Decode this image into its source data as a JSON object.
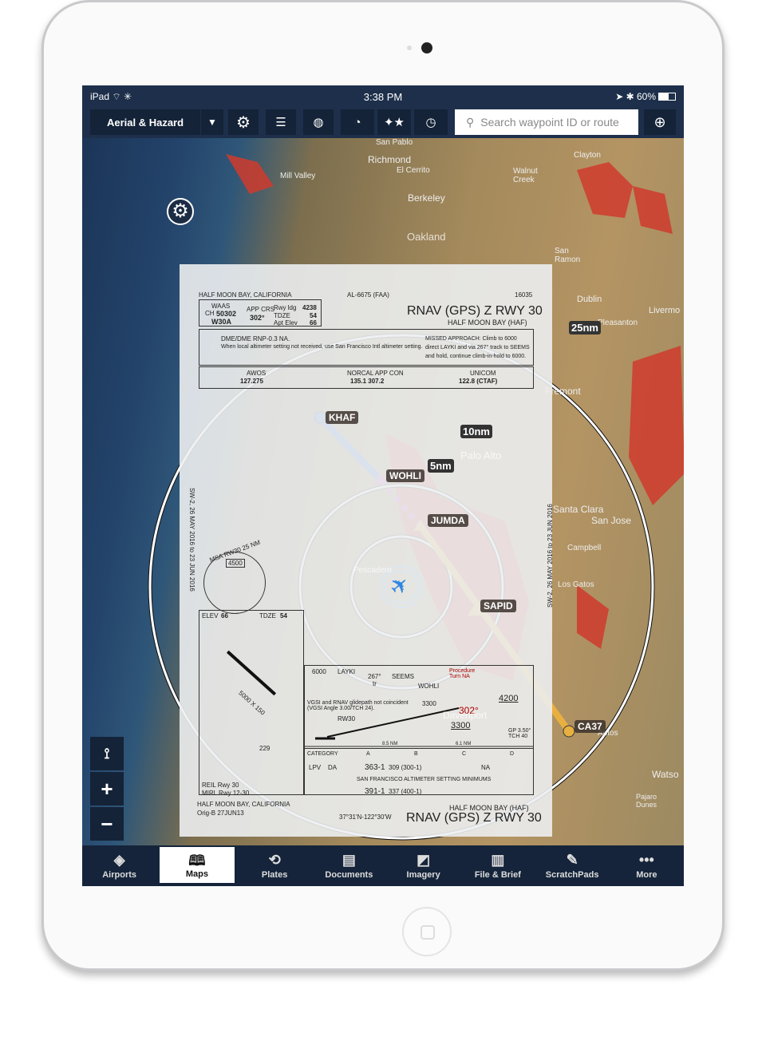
{
  "status_bar": {
    "device": "iPad",
    "time": "3:38 PM",
    "battery": "60%"
  },
  "toolbar": {
    "layer_selector": "Aerial & Hazard",
    "search_placeholder": "Search waypoint ID or route",
    "icons": [
      "gear-icon",
      "list-icon",
      "globe-icon",
      "gauge-icon",
      "stars-icon",
      "clock-icon",
      "crosshair-icon"
    ]
  },
  "map": {
    "range_rings": [
      "5nm",
      "10nm",
      "25nm"
    ],
    "waypoints": [
      "KHAF",
      "WOHLI",
      "JUMDA",
      "SAPID",
      "CA37"
    ],
    "place_labels": [
      "San Pablo",
      "Richmond",
      "El Cerrito",
      "Mill Valley",
      "Berkeley",
      "Walnut Creek",
      "Clayton",
      "Oakland",
      "San Ramon",
      "Dublin",
      "Livermo",
      "Pleasanton",
      "Fremont",
      "Palo Alto",
      "Santa Clara",
      "San Jose",
      "Campbell",
      "Los Gatos",
      "Aptos",
      "Watso",
      "Pajaro Dunes",
      "Davenport",
      "Pescadero"
    ]
  },
  "plate": {
    "location": "HALF MOON BAY, CALIFORNIA",
    "faa_id": "AL-6675 (FAA)",
    "edition": "16035",
    "title": "RNAV (GPS) Z RWY 30",
    "airport": "HALF MOON BAY (HAF)",
    "waas": "WAAS",
    "ch": "CH",
    "ch_num": "50302",
    "waas_id": "W30A",
    "app_crs_label": "APP CRS",
    "app_crs": "302°",
    "rwy_ldg": "Rwy ldg",
    "rwy_ldg_val": "4238",
    "tdze": "TDZE",
    "tdze_val": "54",
    "apt_elev": "Apt Elev",
    "apt_elev_val": "66",
    "notes": "DME/DME RNP-0.3 NA.",
    "notes2": "When local altimeter setting not received, use San Francisco Intl altimeter setting.",
    "missed": "MISSED APPROACH: Climb to 6000 direct LAYKI and via 267° track to SEEMS and hold, continue climb-in-hold to 6000.",
    "awos": "AWOS",
    "awos_freq": "127.275",
    "norcal": "NORCAL APP CON",
    "norcal_freq": "135.1  307.2",
    "unicom": "UNICOM",
    "unicom_freq": "122.8 (CTAF)",
    "msa": "MSA RW30 25 NM",
    "msa_alt": "4500",
    "elev": "ELEV",
    "elev_val": "66",
    "tdze2": "TDZE",
    "tdze2_val": "54",
    "side_text": "SW-2, 26 MAY 2016 to 23 JUN 2016",
    "profile": {
      "alt": "6000",
      "layki": "LAYKI",
      "track": "267°",
      "tr": "tr",
      "seems": "SEEMS",
      "wohli": "WOHLI",
      "wohli_alt": "3300",
      "gs_note": "VGSI and RNAV glidepath not coincident (VGSI Angle 3.00/TCH 24).",
      "rw30": "RW30",
      "crs": "302°",
      "alt2": "3300",
      "alt3": "4200",
      "gp": "GP 3.50° TCH 40",
      "d1": "8.5 NM",
      "d2": "6.1 NM",
      "proc": "Procedure Turn NA"
    },
    "minimums": {
      "headers": [
        "CATEGORY",
        "A",
        "B",
        "C",
        "D"
      ],
      "lpv": "LPV",
      "da": "DA",
      "lpv_val": "363-1",
      "lpv_val2": "309 (300-1)",
      "na": "NA",
      "sf": "SAN FRANCISCO ALTIMETER SETTING MINIMUMS",
      "lpv2_val": "391-1",
      "lpv2_val2": "337 (400-1)"
    },
    "reil": "REIL Rwy 30",
    "mirl": "MIRL Rwy 12-30",
    "rwy_dim": "5000 X 150",
    "obst": "229",
    "footer_loc": "HALF MOON BAY, CALIFORNIA",
    "orig": "Orig-B  27JUN13",
    "coords": "37°31'N-122°30'W"
  },
  "map_controls": [
    "route-icon",
    "+",
    "−"
  ],
  "tabs": [
    {
      "label": "Airports",
      "icon": "airport-icon"
    },
    {
      "label": "Maps",
      "icon": "map-icon",
      "active": true
    },
    {
      "label": "Plates",
      "icon": "plates-icon"
    },
    {
      "label": "Documents",
      "icon": "documents-icon"
    },
    {
      "label": "Imagery",
      "icon": "imagery-icon"
    },
    {
      "label": "File & Brief",
      "icon": "file-brief-icon"
    },
    {
      "label": "ScratchPads",
      "icon": "scratchpad-icon"
    },
    {
      "label": "More",
      "icon": "more-icon"
    }
  ],
  "colors": {
    "toolbar": "#142338",
    "hazard": "#d63a2c",
    "route_active": "#3a6fd8",
    "route_future": "#e8b040"
  }
}
